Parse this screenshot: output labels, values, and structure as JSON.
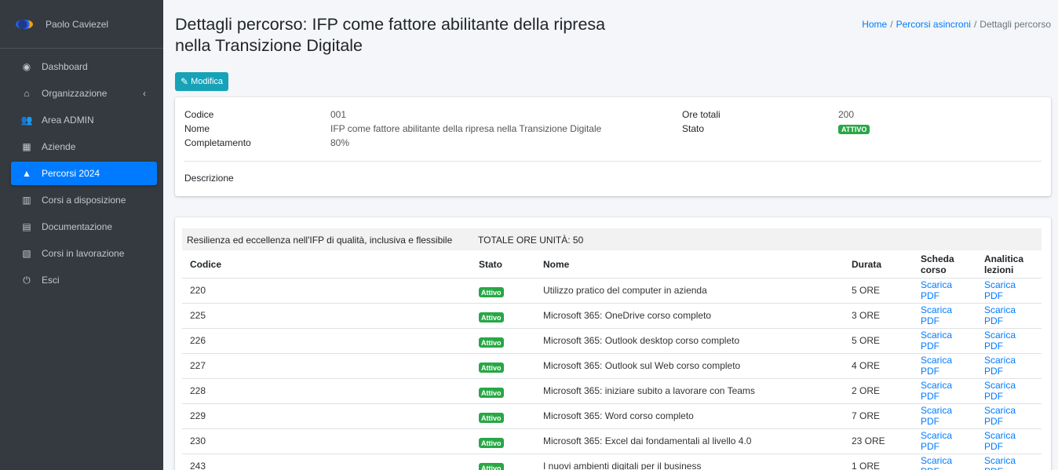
{
  "sidebar": {
    "user_name": "Paolo Caviezel",
    "items": [
      {
        "label": "Dashboard",
        "icon": "dashboard-icon",
        "glyph": "◉"
      },
      {
        "label": "Organizzazione",
        "icon": "bank-icon",
        "glyph": "⌂"
      },
      {
        "label": "Area ADMIN",
        "icon": "users-icon",
        "glyph": "👥"
      },
      {
        "label": "Aziende",
        "icon": "building-icon",
        "glyph": "▦"
      },
      {
        "label": "Percorsi 2024",
        "icon": "road-icon",
        "glyph": "▲"
      },
      {
        "label": "Corsi a disposizione",
        "icon": "book-icon",
        "glyph": "▥"
      },
      {
        "label": "Documentazione",
        "icon": "pdf-file-icon",
        "glyph": "▤"
      },
      {
        "label": "Corsi in lavorazione",
        "icon": "excel-file-icon",
        "glyph": "▧"
      },
      {
        "label": "Esci",
        "icon": "power-icon",
        "glyph": "⏻"
      }
    ],
    "active_index": 4
  },
  "header": {
    "title": "Dettagli percorso: IFP come fattore abilitante della ripresa nella Transizione Digitale",
    "breadcrumb": [
      "Home",
      "Percorsi asincroni",
      "Dettagli percorso"
    ],
    "edit_label": "Modifica"
  },
  "details": {
    "codice_label": "Codice",
    "codice": "001",
    "nome_label": "Nome",
    "nome": "IFP come fattore abilitante della ripresa nella Transizione Digitale",
    "completamento_label": "Completamento",
    "completamento": "80%",
    "ore_label": "Ore totali",
    "ore": "200",
    "stato_label": "Stato",
    "stato": "ATTIVO",
    "descrizione_label": "Descrizione"
  },
  "unit": {
    "title": "Resilienza ed eccellenza nell'IFP di qualità, inclusiva e flessibile",
    "total": "TOTALE ORE UNITÀ: 50",
    "columns": [
      "Codice",
      "Stato",
      "Nome",
      "Durata",
      "Scheda corso",
      "Analitica lezioni"
    ],
    "rows": [
      {
        "codice": "220",
        "stato": "Attivo",
        "nome": "Utilizzo pratico del computer in azienda",
        "durata": "5 ORE",
        "scheda": "Scarica PDF",
        "analitica": "Scarica PDF"
      },
      {
        "codice": "225",
        "stato": "Attivo",
        "nome": "Microsoft 365: OneDrive corso completo",
        "durata": "3 ORE",
        "scheda": "Scarica PDF",
        "analitica": "Scarica PDF"
      },
      {
        "codice": "226",
        "stato": "Attivo",
        "nome": "Microsoft 365: Outlook desktop corso completo",
        "durata": "5 ORE",
        "scheda": "Scarica PDF",
        "analitica": "Scarica PDF"
      },
      {
        "codice": "227",
        "stato": "Attivo",
        "nome": "Microsoft 365: Outlook sul Web corso completo",
        "durata": "4 ORE",
        "scheda": "Scarica PDF",
        "analitica": "Scarica PDF"
      },
      {
        "codice": "228",
        "stato": "Attivo",
        "nome": "Microsoft 365: iniziare subito a lavorare con Teams",
        "durata": "2 ORE",
        "scheda": "Scarica PDF",
        "analitica": "Scarica PDF"
      },
      {
        "codice": "229",
        "stato": "Attivo",
        "nome": "Microsoft 365: Word corso completo",
        "durata": "7 ORE",
        "scheda": "Scarica PDF",
        "analitica": "Scarica PDF"
      },
      {
        "codice": "230",
        "stato": "Attivo",
        "nome": "Microsoft 365: Excel dai fondamentali al livello 4.0",
        "durata": "23 ORE",
        "scheda": "Scarica PDF",
        "analitica": "Scarica PDF"
      },
      {
        "codice": "243",
        "stato": "Attivo",
        "nome": "I nuovi ambienti digitali per il business",
        "durata": "1 ORE",
        "scheda": "Scarica PDF",
        "analitica": "Scarica PDF"
      }
    ]
  }
}
